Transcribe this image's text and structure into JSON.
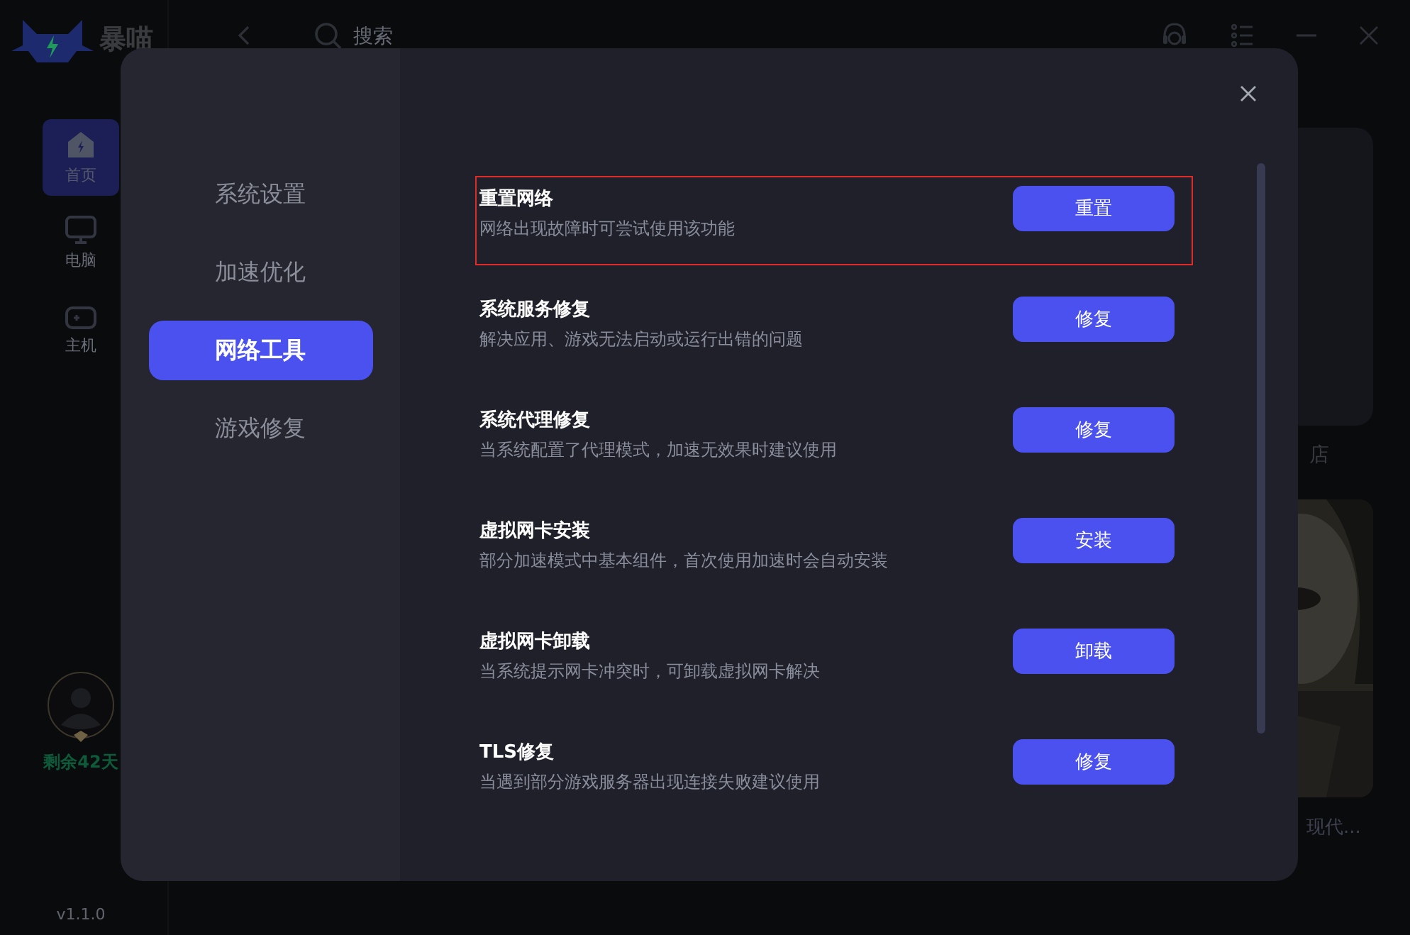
{
  "app": {
    "logo_text": "暴喵",
    "nav": [
      {
        "label": "首页",
        "kind": "home",
        "selected": true
      },
      {
        "label": "电脑",
        "kind": "monitor",
        "selected": false
      },
      {
        "label": "主机",
        "kind": "gamepad",
        "selected": false
      }
    ],
    "membership": "剩余**42**天",
    "version": "v1.1.0"
  },
  "topbar": {
    "search": {
      "placeholder": "搜索"
    }
  },
  "background": {
    "store_label": "店",
    "game_title": "现代..."
  },
  "dialog": {
    "tabs": [
      {
        "label": "系统设置",
        "selected": false
      },
      {
        "label": "加速优化",
        "selected": false
      },
      {
        "label": "网络工具",
        "selected": true
      },
      {
        "label": "游戏修复",
        "selected": false
      }
    ],
    "tools": [
      {
        "title": "重置网络",
        "description": "网络出现故障时可尝试使用该功能",
        "button": "重置",
        "highlighted": true
      },
      {
        "title": "系统服务修复",
        "description": "解决应用、游戏无法启动或运行出错的问题",
        "button": "修复",
        "highlighted": false
      },
      {
        "title": "系统代理修复",
        "description": "当系统配置了代理模式，加速无效果时建议使用",
        "button": "修复",
        "highlighted": false
      },
      {
        "title": "虚拟网卡安装",
        "description": "部分加速模式中基本组件，首次使用加速时会自动安装",
        "button": "安装",
        "highlighted": false
      },
      {
        "title": "虚拟网卡卸载",
        "description": "当系统提示网卡冲突时，可卸载虚拟网卡解决",
        "button": "卸载",
        "highlighted": false
      },
      {
        "title": "TLS修复",
        "description": "当遇到部分游戏服务器出现连接失败建议使用",
        "button": "修复",
        "highlighted": false
      }
    ]
  }
}
